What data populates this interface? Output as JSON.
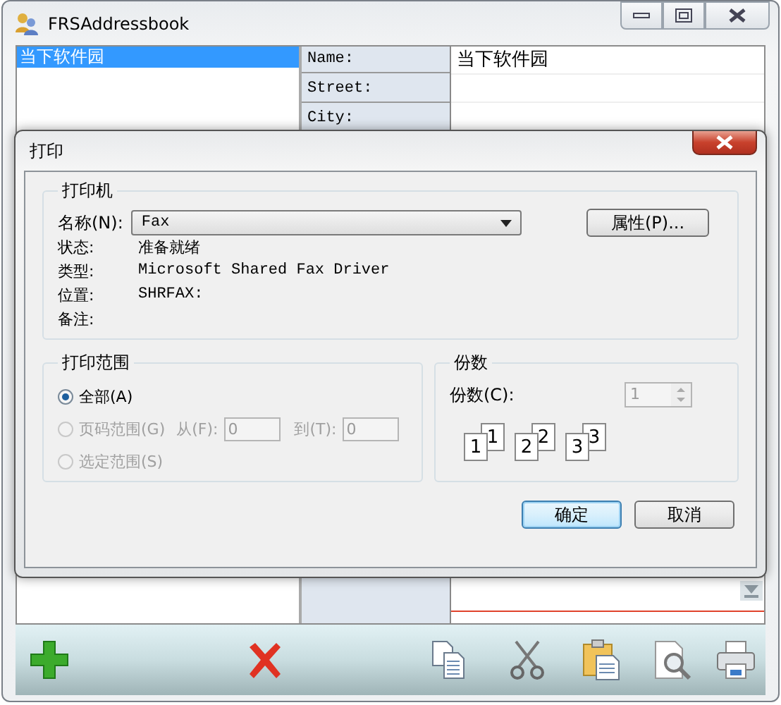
{
  "window": {
    "title": "FRSAddressbook"
  },
  "contacts": [
    {
      "name": "当下软件园",
      "selected": true
    }
  ],
  "fields": [
    {
      "label": "Name:",
      "value": "当下软件园"
    },
    {
      "label": "Street:"
    },
    {
      "label": "City:"
    }
  ],
  "dialog": {
    "title": "打印",
    "printer": {
      "legend": "打印机",
      "name_label": "名称(N):",
      "name_value": "Fax",
      "properties_button": "属性(P)...",
      "info": [
        {
          "label": "状态:",
          "value": "准备就绪"
        },
        {
          "label": "类型:",
          "value": "Microsoft Shared Fax Driver"
        },
        {
          "label": "位置:",
          "value": "SHRFAX:"
        },
        {
          "label": "备注:"
        }
      ]
    },
    "range": {
      "legend": "打印范围",
      "options": [
        {
          "label": "全部(A)",
          "selected": true,
          "disabled": false
        },
        {
          "label": "页码范围(G)",
          "selected": false,
          "disabled": true
        },
        {
          "label": "选定范围(S)",
          "selected": false,
          "disabled": true
        }
      ],
      "from_label": "从(F):",
      "from_value": "0",
      "to_label": "到(T):",
      "to_value": "0"
    },
    "copies": {
      "legend": "份数",
      "label": "份数(C):",
      "value": "1",
      "disabled": true,
      "pages": [
        {
          "front": "1",
          "back": "1"
        },
        {
          "front": "2",
          "back": "2"
        },
        {
          "front": "3",
          "back": "3"
        }
      ]
    },
    "buttons": [
      {
        "label": "确定",
        "default": true
      },
      {
        "label": "取消",
        "default": false
      }
    ]
  }
}
